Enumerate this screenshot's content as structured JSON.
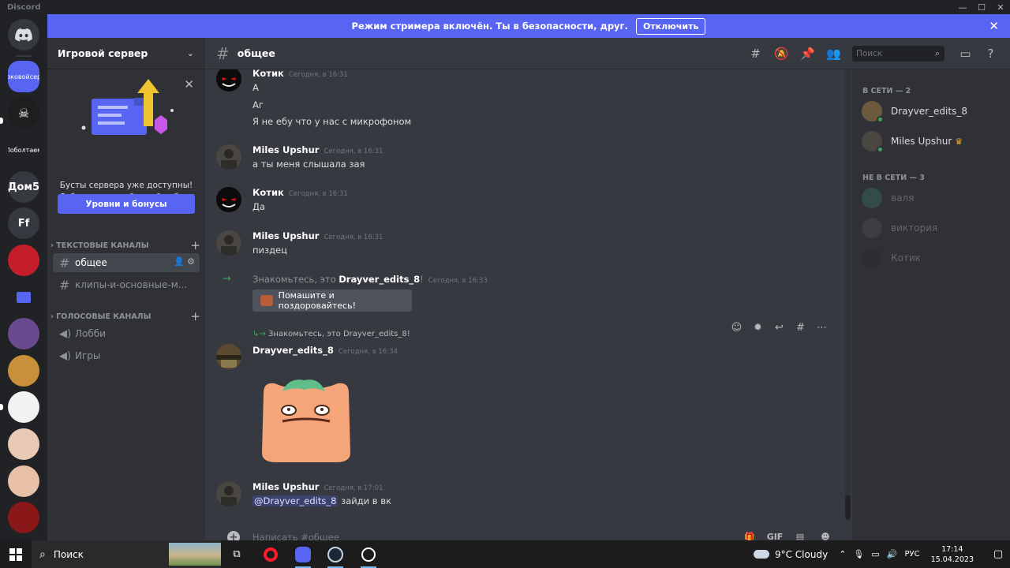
{
  "window": {
    "title": "Discord"
  },
  "rail": {
    "servers": [
      {
        "label": "роковойсерв",
        "color": "#5865f2"
      },
      {
        "label": "",
        "color": "#1e1e1e"
      },
      {
        "label": "Поболтаем",
        "color": "#202225"
      },
      {
        "label": "Дом5",
        "color": "#36393f"
      },
      {
        "label": "Ff",
        "color": "#36393f"
      },
      {
        "label": "",
        "color": "#c41e2a"
      },
      {
        "label": "",
        "color": "#3c64c8"
      },
      {
        "label": "",
        "color": "#6a4a8e"
      },
      {
        "label": "",
        "color": "#c8903a"
      },
      {
        "label": "",
        "color": "#f2f2f2"
      },
      {
        "label": "",
        "color": "#e8c9b4"
      },
      {
        "label": "",
        "color": "#e8c0a8"
      },
      {
        "label": "",
        "color": "#8a1818"
      }
    ]
  },
  "banner": {
    "text": "Режим стримера включён. Ты в безопасности, друг.",
    "button": "Отключить"
  },
  "sidebar": {
    "server_name": "Игровой сервер",
    "boost": {
      "text": "Бусты сервера уже доступны! Соберите друзей и дайте буст своему серверу.",
      "button": "Уровни и бонусы"
    },
    "categories": [
      {
        "label": "ТЕКСТОВЫЕ КАНАЛЫ",
        "channels": [
          {
            "name": "общее",
            "active": true
          },
          {
            "name": "клипы-и-основные-м...",
            "active": false
          }
        ]
      },
      {
        "label": "ГОЛОСОВЫЕ КАНАЛЫ",
        "channels": [
          {
            "name": "Лобби"
          },
          {
            "name": "Игры"
          }
        ]
      }
    ]
  },
  "header": {
    "channel": "общее",
    "search_placeholder": "Поиск"
  },
  "messages": [
    {
      "author": "Котик",
      "time": "Сегодня, в 16:31",
      "lines": [
        "А",
        "Аг",
        "Я не ебу что у нас с микрофоном"
      ]
    },
    {
      "author": "Miles Upshur",
      "time": "Сегодня, в 16:31",
      "lines": [
        "а ты меня слышала зая"
      ]
    },
    {
      "author": "Котик",
      "time": "Сегодня, в 16:31",
      "lines": [
        "Да"
      ]
    },
    {
      "author": "Miles Upshur",
      "time": "Сегодня, в 16:31",
      "lines": [
        "пиздец"
      ]
    },
    {
      "system_prefix": "Знакомьтесь, это",
      "user": "Drayver_edits_8",
      "suffix": "!",
      "time": "Сегодня, в 16:33",
      "wave_button": "Помашите и поздоровайтесь!"
    },
    {
      "reply_text": "Знакомьтесь, это Drayver_edits_8!",
      "author": "Drayver_edits_8",
      "time": "Сегодня, в 16:34"
    },
    {
      "author": "Miles Upshur",
      "time": "Сегодня, в 17:01",
      "mention": "@Drayver_edits_8",
      "text": " зайди в вк"
    }
  ],
  "composer": {
    "placeholder": "Написать #общее",
    "gif_label": "GIF"
  },
  "members": {
    "online_header": "В СЕТИ — 2",
    "offline_header": "НЕ В СЕТИ — 3",
    "online": [
      {
        "name": "Drayver_edits_8",
        "color": "#6b5a3e"
      },
      {
        "name": "Miles Upshur",
        "color": "#4a4642",
        "crown": true
      }
    ],
    "offline": [
      {
        "name": "валя",
        "color": "#3f8a6a"
      },
      {
        "name": "виктория",
        "color": "#5a5a5a"
      },
      {
        "name": "Котик",
        "color": "#2a2a2a"
      }
    ]
  },
  "taskbar": {
    "search": "Поиск",
    "weather": "9°C Cloudy",
    "lang": "РУС",
    "time": "17:14",
    "date": "15.04.2023"
  }
}
